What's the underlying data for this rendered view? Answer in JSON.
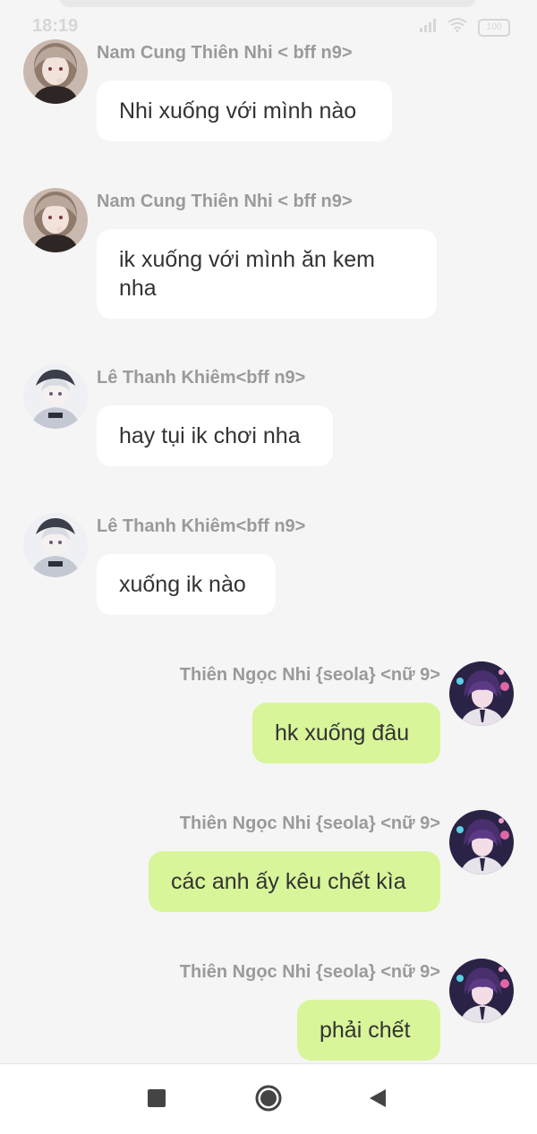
{
  "status_bar": {
    "time": "18:19",
    "battery": "100"
  },
  "messages": [
    {
      "side": "left",
      "sender": "Nam Cung Thiên Nhi < bff n9>",
      "text": "Nhi xuống với mình nào",
      "avatar_icon": "avatar-girl-icon"
    },
    {
      "side": "left",
      "sender": "Nam Cung Thiên Nhi < bff n9>",
      "text": "ik xuống với mình ăn kem nha",
      "avatar_icon": "avatar-girl-icon"
    },
    {
      "side": "left",
      "sender": "Lê Thanh Khiêm<bff n9>",
      "text": "hay tụi ik chơi nha",
      "avatar_icon": "avatar-boy-icon"
    },
    {
      "side": "left",
      "sender": "Lê Thanh Khiêm<bff n9>",
      "text": "xuống ik nào",
      "avatar_icon": "avatar-boy-icon"
    },
    {
      "side": "right",
      "sender": "Thiên Ngọc Nhi {seola} <nữ 9>",
      "text": "hk xuống đâu",
      "avatar_icon": "avatar-self-icon"
    },
    {
      "side": "right",
      "sender": "Thiên Ngọc Nhi {seola} <nữ 9>",
      "text": "các anh ấy kêu chết kìa",
      "avatar_icon": "avatar-self-icon"
    },
    {
      "side": "right",
      "sender": "Thiên Ngọc Nhi {seola} <nữ 9>",
      "text": "phải chết",
      "avatar_icon": "avatar-self-icon"
    }
  ],
  "nav_bar": {
    "recents_icon": "square-icon",
    "home_icon": "circle-icon",
    "back_icon": "triangle-back-icon"
  },
  "colors": {
    "background": "#f5f5f5",
    "incoming_bubble": "#ffffff",
    "outgoing_bubble": "#d8f59a",
    "sender_text": "#9a9a9a",
    "message_text": "#333333"
  }
}
